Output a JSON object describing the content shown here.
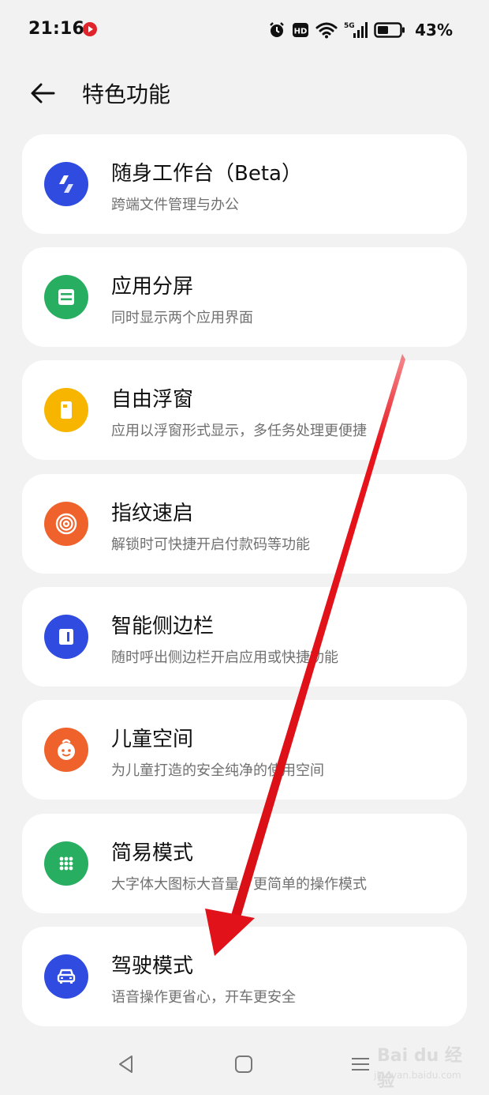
{
  "status_bar": {
    "time": "21:16",
    "battery_percent": "43%",
    "network_label": "5G",
    "hd_label": "HD"
  },
  "header": {
    "title": "特色功能"
  },
  "features": [
    {
      "title": "随身工作台（Beta）",
      "subtitle": "跨端文件管理与办公",
      "color": "#2f4be0",
      "icon": "workbench-icon"
    },
    {
      "title": "应用分屏",
      "subtitle": "同时显示两个应用界面",
      "color": "#27ae60",
      "icon": "split-screen-icon"
    },
    {
      "title": "自由浮窗",
      "subtitle": "应用以浮窗形式显示，多任务处理更便捷",
      "color": "#f7b500",
      "icon": "floating-window-icon"
    },
    {
      "title": "指纹速启",
      "subtitle": "解锁时可快捷开启付款码等功能",
      "color": "#f0622c",
      "icon": "fingerprint-icon"
    },
    {
      "title": "智能侧边栏",
      "subtitle": "随时呼出侧边栏开启应用或快捷功能",
      "color": "#2f4be0",
      "icon": "sidebar-icon"
    },
    {
      "title": "儿童空间",
      "subtitle": "为儿童打造的安全纯净的使用空间",
      "color": "#f0622c",
      "icon": "kid-face-icon"
    },
    {
      "title": "简易模式",
      "subtitle": "大字体大图标大音量，更简单的操作模式",
      "color": "#27ae60",
      "icon": "grid-dots-icon"
    },
    {
      "title": "驾驶模式",
      "subtitle": "语音操作更省心，开车更安全",
      "color": "#2f4be0",
      "icon": "car-icon"
    }
  ],
  "watermark": {
    "main": "Bai du 经验",
    "sub": "jingyan.baidu.com"
  },
  "annotation_color": "#e8131b"
}
